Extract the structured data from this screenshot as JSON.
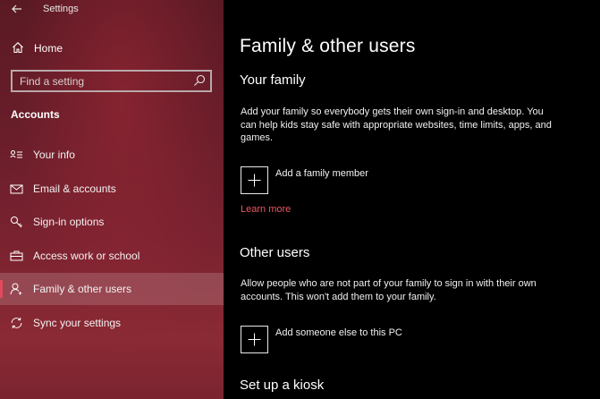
{
  "app": {
    "title": "Settings"
  },
  "sidebar": {
    "home_label": "Home",
    "search": {
      "placeholder": "Find a setting",
      "value": ""
    },
    "section_label": "Accounts",
    "items": [
      {
        "label": "Your info",
        "icon": "person-card-icon"
      },
      {
        "label": "Email & accounts",
        "icon": "mail-icon"
      },
      {
        "label": "Sign-in options",
        "icon": "key-icon"
      },
      {
        "label": "Access work or school",
        "icon": "briefcase-icon"
      },
      {
        "label": "Family & other users",
        "icon": "person-add-icon",
        "selected": true
      },
      {
        "label": "Sync your settings",
        "icon": "sync-icon"
      }
    ],
    "accent": "#e04a5a"
  },
  "main": {
    "title": "Family & other users",
    "your_family": {
      "heading": "Your family",
      "description": "Add your family so everybody gets their own sign-in and desktop. You can help kids stay safe with appropriate websites, time limits, apps, and games.",
      "add_label": "Add a family member",
      "learn_more": "Learn more"
    },
    "other_users": {
      "heading": "Other users",
      "description": "Allow people who are not part of your family to sign in with their own accounts. This won't add them to your family.",
      "add_label": "Add someone else to this PC"
    },
    "kiosk": {
      "heading": "Set up a kiosk"
    },
    "link_color": "#e85a62"
  }
}
